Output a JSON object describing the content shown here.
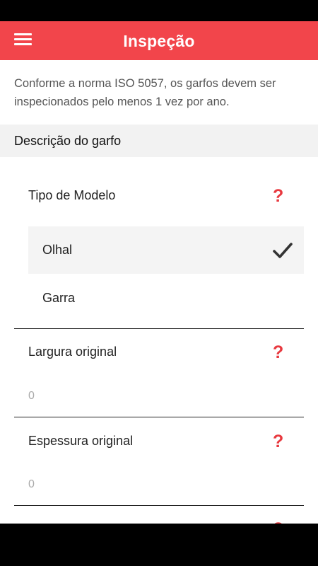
{
  "header": {
    "title": "Inspeção",
    "menu_icon": "hamburger-menu-icon",
    "background_color": "#f2454b"
  },
  "intro_text": "Conforme a norma ISO 5057, os garfos devem ser inspecionados pelo menos 1 vez por ano.",
  "section": {
    "title": "Descrição do garfo"
  },
  "fields": {
    "tipo_modelo": {
      "label": "Tipo de Modelo",
      "help_symbol": "?",
      "options": [
        {
          "label": "Olhal",
          "selected": true
        },
        {
          "label": "Garra",
          "selected": false
        }
      ]
    },
    "largura_original": {
      "label": "Largura original",
      "help_symbol": "?",
      "placeholder": "0"
    },
    "espessura_original": {
      "label": "Espessura original",
      "help_symbol": "?",
      "placeholder": "0"
    },
    "next_field": {
      "help_symbol": "?"
    }
  },
  "colors": {
    "accent": "#e8393f",
    "selected_row": "#f4f4f4",
    "section_bg": "#f2f2f2"
  }
}
